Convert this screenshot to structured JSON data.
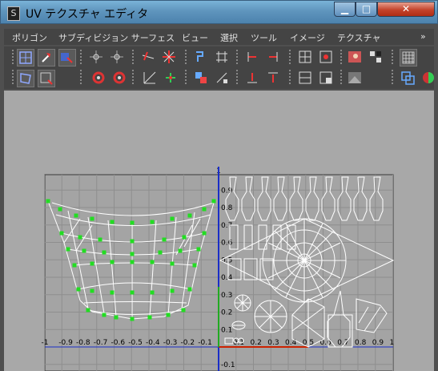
{
  "window": {
    "title": "UV テクスチャ エディタ",
    "min_glyph": "▁",
    "max_glyph": "□",
    "close_glyph": "✕",
    "icon_glyph": "S"
  },
  "menu": {
    "items": [
      "ポリゴン",
      "サブディビジョン サーフェス",
      "ビュー",
      "選択",
      "ツール",
      "イメージ",
      "テクスチャ"
    ],
    "overflow": "»"
  },
  "axis": {
    "x_ticks": [
      "-1",
      "-0.9",
      "-0.8",
      "-0.7",
      "-0.6",
      "-0.5",
      "-0.4",
      "-0.3",
      "-0.2",
      "-0.1",
      "0.1",
      "0.2",
      "0.3",
      "0.4",
      "0.5",
      "0.6",
      "0.7",
      "0.8",
      "0.9",
      "1"
    ],
    "y_ticks": [
      "0.9",
      "0.8",
      "0.7",
      "0.6",
      "0.5",
      "0.4",
      "0.3",
      "0.2",
      "0.1",
      "-0.1"
    ],
    "y_top": "1"
  },
  "colors": {
    "uv_wire": "#ffffff",
    "selected_vertex": "#22dd22",
    "u_axis": "#cc2200",
    "v_axis": "#22aa22",
    "grid_axis": "#1a2ec8"
  },
  "icons": [
    "select-uv-icon",
    "move-uv-icon",
    "lasso-icon",
    "grid-icon",
    "paint-select-icon",
    "flip-u-icon",
    "flip-v-icon",
    "rotate-cw-icon",
    "rotate-ccw-icon",
    "cut-edge-icon",
    "sew-edge-icon",
    "unfold-icon",
    "layout-icon",
    "align-icon",
    "snap-icon",
    "normalize-icon",
    "distribute-icon",
    "image-icon",
    "checker-icon",
    "display-grid-icon",
    "texture-icon"
  ]
}
